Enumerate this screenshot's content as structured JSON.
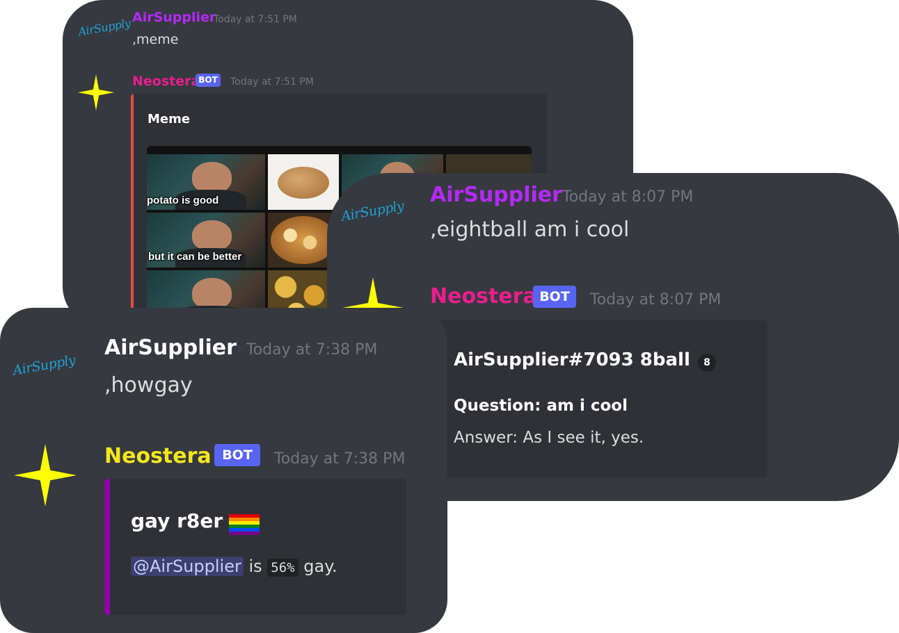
{
  "meme_panel": {
    "user": {
      "name": "AirSupplier",
      "timestamp": "Today at 7:51 PM",
      "message": ",meme",
      "logo_text": "AirSupply",
      "name_color": "#b429f9"
    },
    "bot": {
      "name": "Neostera",
      "badge": "BOT",
      "timestamp": "Today at 7:51 PM",
      "name_color": "#e91e8c"
    },
    "embed": {
      "title": "Meme",
      "bar_color": "#e74c3c",
      "captions": [
        "potato is good",
        "but it can be better"
      ]
    }
  },
  "eightball_panel": {
    "user": {
      "name": "AirSupplier",
      "timestamp": "Today at 8:07 PM",
      "message": ",eightball am i cool",
      "logo_text": "AirSupply",
      "name_color": "#b429f9"
    },
    "bot": {
      "name": "Neostera",
      "badge": "BOT",
      "timestamp": "Today at 8:07 PM",
      "name_color": "#e91e8c"
    },
    "embed": {
      "title": "AirSupplier#7093 8ball",
      "ball_glyph": "8",
      "question": "Question: am i cool",
      "answer": "Answer: As I see it, yes."
    }
  },
  "howgay_panel": {
    "user": {
      "name": "AirSupplier",
      "timestamp": "Today at 7:38 PM",
      "message": ",howgay",
      "logo_text": "AirSupply",
      "name_color": "#ffffff"
    },
    "bot": {
      "name": "Neostera",
      "badge": "BOT",
      "timestamp": "Today at 7:38 PM",
      "name_color": "#f5e61b"
    },
    "embed": {
      "title": "gay r8er",
      "bar_color": "#8e00a8",
      "mention": "@AirSupplier",
      "text_is": "is",
      "percent": "56%",
      "text_gay": "gay."
    }
  },
  "icons": {
    "user_avatar": "airsupply-logo",
    "bot_avatar": "yellow-star-icon",
    "flag": "rainbow-flag-icon",
    "ball": "8ball-icon"
  },
  "colors": {
    "background": "#36393f",
    "embed": "#2f3136",
    "timestamp": "#72767d",
    "text": "#dcddde",
    "bot_badge": "#5865f2",
    "star": "#ffff00"
  }
}
